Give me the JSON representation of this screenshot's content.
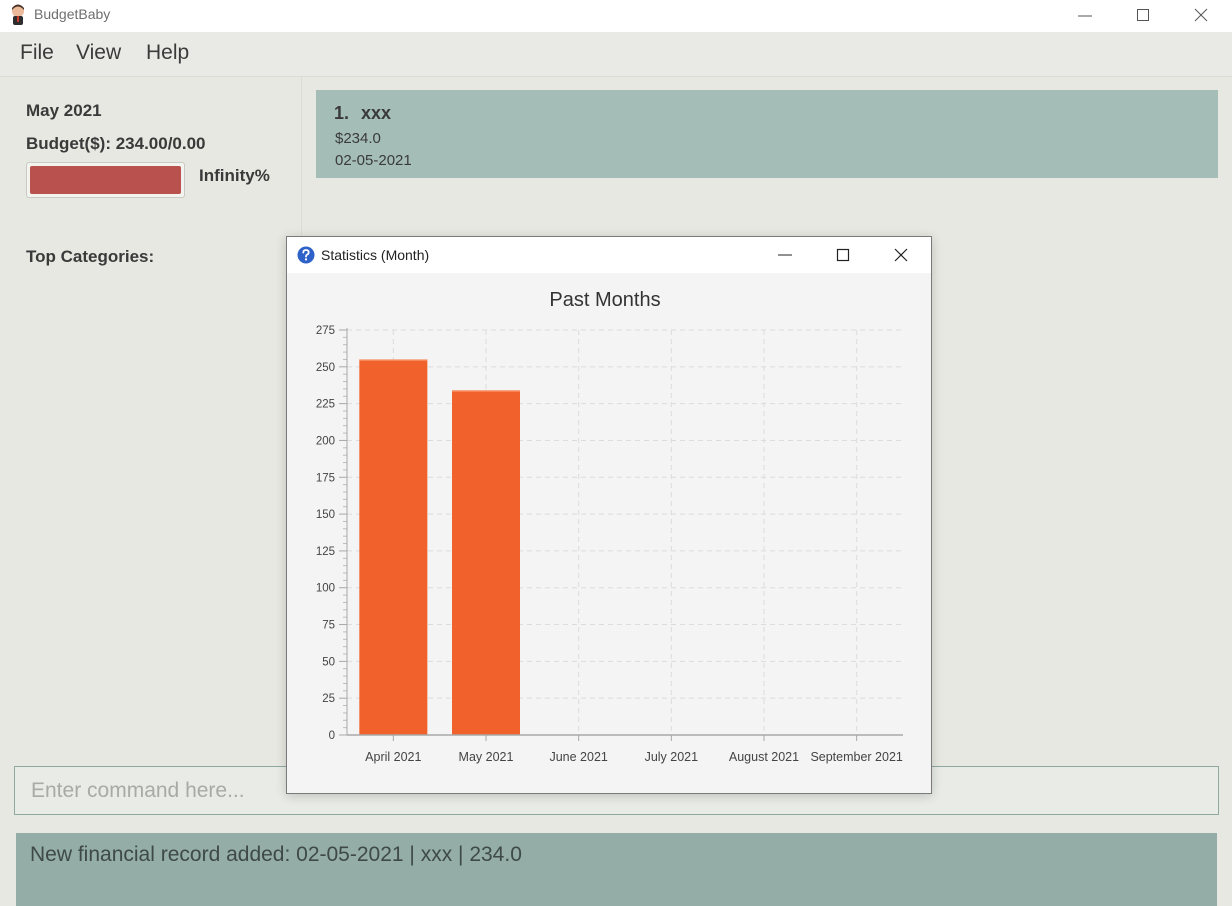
{
  "window": {
    "title": "BudgetBaby",
    "icon": "baby-icon",
    "controls": [
      "minimize-icon",
      "maximize-icon",
      "close-icon"
    ]
  },
  "menu": {
    "items": [
      {
        "label": "File"
      },
      {
        "label": "View"
      },
      {
        "label": "Help"
      }
    ]
  },
  "summary": {
    "month": "May 2021",
    "budget": "Budget($): 234.00/0.00",
    "progress_fraction": 1.0,
    "progress_color": "#b9524e",
    "progress_percent_text": "Infinity%",
    "top_categories_label": "Top Categories:"
  },
  "records": [
    {
      "index": "1.",
      "description": "xxx",
      "amount": "$234.0",
      "date": "02-05-2021"
    }
  ],
  "command": {
    "placeholder": "Enter command here...",
    "value": ""
  },
  "result": {
    "message": "New financial record added: 02-05-2021 | xxx | 234.0"
  },
  "dialog": {
    "title": "Statistics (Month)",
    "icon": "help-icon",
    "controls": [
      "minimize-icon",
      "maximize-icon",
      "close-icon"
    ]
  },
  "chart_data": {
    "type": "bar",
    "title": "Past Months",
    "categories": [
      "April 2021",
      "May 2021",
      "June 2021",
      "July 2021",
      "August 2021",
      "September 2021"
    ],
    "values": [
      255,
      234,
      0,
      0,
      0,
      0
    ],
    "ylim": [
      0,
      275
    ],
    "yticks": [
      0,
      25,
      50,
      75,
      100,
      125,
      150,
      175,
      200,
      225,
      250,
      275
    ],
    "bar_color": "#f0612b",
    "grid": true,
    "legend": false
  }
}
